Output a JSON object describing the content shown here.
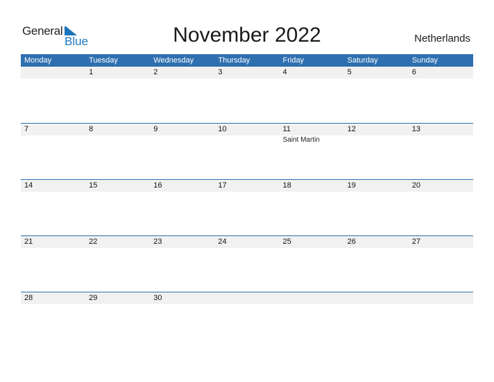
{
  "logo": {
    "word1": "General",
    "word2": "Blue"
  },
  "header": {
    "title": "November 2022",
    "country": "Netherlands"
  },
  "colors": {
    "accent": "#2e6fb0",
    "date_row_bg": "#f1f1f1",
    "logo_blue": "#1b75bc"
  },
  "weekdays": [
    "Monday",
    "Tuesday",
    "Wednesday",
    "Thursday",
    "Friday",
    "Saturday",
    "Sunday"
  ],
  "weeks": [
    {
      "days": [
        "",
        "1",
        "2",
        "3",
        "4",
        "5",
        "6"
      ],
      "events": [
        "",
        "",
        "",
        "",
        "",
        "",
        ""
      ]
    },
    {
      "days": [
        "7",
        "8",
        "9",
        "10",
        "11",
        "12",
        "13"
      ],
      "events": [
        "",
        "",
        "",
        "",
        "Saint Martin",
        "",
        ""
      ]
    },
    {
      "days": [
        "14",
        "15",
        "16",
        "17",
        "18",
        "19",
        "20"
      ],
      "events": [
        "",
        "",
        "",
        "",
        "",
        "",
        ""
      ]
    },
    {
      "days": [
        "21",
        "22",
        "23",
        "24",
        "25",
        "26",
        "27"
      ],
      "events": [
        "",
        "",
        "",
        "",
        "",
        "",
        ""
      ]
    },
    {
      "days": [
        "28",
        "29",
        "30"
      ],
      "events": [
        "",
        "",
        ""
      ]
    }
  ]
}
